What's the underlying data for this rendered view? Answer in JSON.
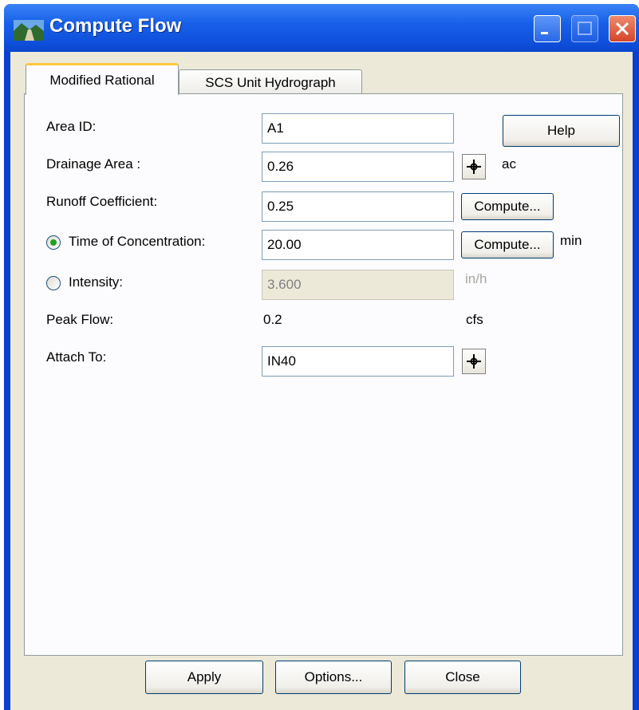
{
  "window": {
    "title": "Compute Flow"
  },
  "tabs": [
    {
      "label": "Modified Rational",
      "active": true
    },
    {
      "label": "SCS Unit Hydrograph",
      "active": false
    }
  ],
  "form": {
    "area_id": {
      "label": "Area ID:",
      "value": "A1"
    },
    "drainage_area": {
      "label": "Drainage Area :",
      "value": "0.26",
      "unit": "ac"
    },
    "runoff_coefficient": {
      "label": "Runoff Coefficient:",
      "value": "0.25",
      "button": "Compute..."
    },
    "time_of_concentration": {
      "label": "Time of Concentration:",
      "value": "20.00",
      "button": "Compute...",
      "unit": "min",
      "selected": true
    },
    "intensity": {
      "label": "Intensity:",
      "value": "3.600",
      "unit": "in/h",
      "selected": false
    },
    "peak_flow": {
      "label": "Peak Flow:",
      "value": "0.2",
      "unit": "cfs"
    },
    "attach_to": {
      "label": "Attach To:",
      "value": "IN40"
    },
    "help_label": "Help"
  },
  "footer": {
    "apply": "Apply",
    "options": "Options...",
    "close": "Close"
  },
  "icons": {
    "pick": "crosshair-pick-icon",
    "app": "landscape-app-icon"
  },
  "colors": {
    "titlebar": "#0f50dc",
    "client": "#ece9d8",
    "active_tab_accent": "#ffc83c",
    "radio_dot": "#21a121"
  }
}
